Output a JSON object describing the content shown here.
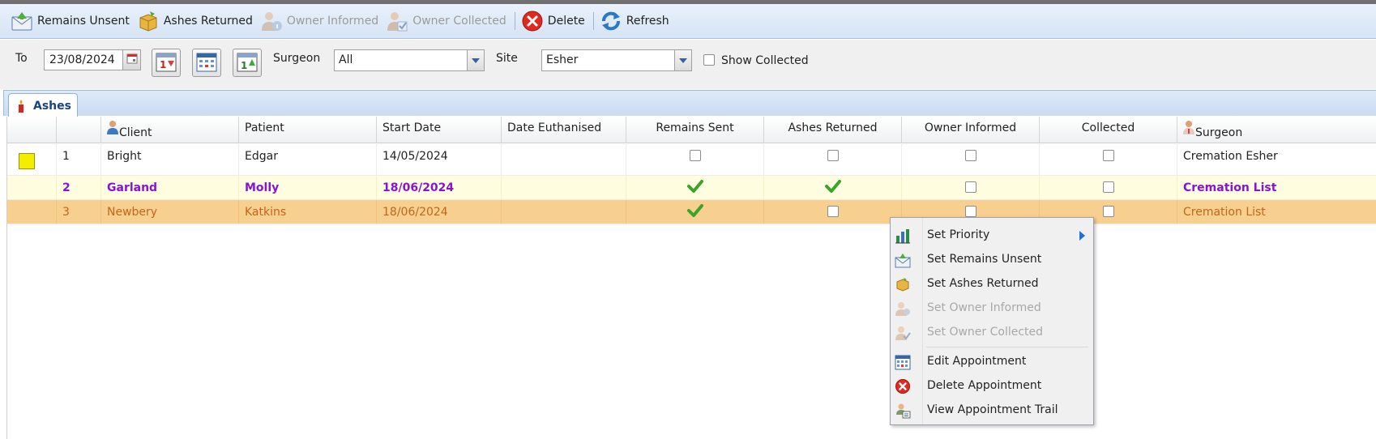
{
  "toolbar": {
    "remains_unsent": "Remains Unsent",
    "ashes_returned": "Ashes Returned",
    "owner_informed": "Owner Informed",
    "owner_collected": "Owner Collected",
    "delete": "Delete",
    "refresh": "Refresh"
  },
  "filters": {
    "to_label": "To",
    "to_date": "23/08/2024",
    "surgeon_label": "Surgeon",
    "surgeon_value": "All",
    "site_label": "Site",
    "site_value": "Esher",
    "show_collected_label": "Show Collected",
    "show_collected_checked": false
  },
  "tabs": [
    {
      "label": "Ashes",
      "icon": "candle-icon"
    }
  ],
  "grid": {
    "columns": [
      "",
      "",
      "Client",
      "Patient",
      "Start Date",
      "Date Euthanised",
      "Remains Sent",
      "Ashes Returned",
      "Owner Informed",
      "Collected",
      "Surgeon"
    ],
    "rows": [
      {
        "priority_color": "#f5ec00",
        "num": "1",
        "client": "Bright",
        "patient": "Edgar",
        "start_date": "14/05/2024",
        "date_euthanised": "",
        "remains_sent": false,
        "ashes_returned": false,
        "owner_informed": false,
        "collected": false,
        "surgeon": "Cremation Esher"
      },
      {
        "priority_color": "",
        "num": "2",
        "client": "Garland",
        "patient": "Molly",
        "start_date": "18/06/2024",
        "date_euthanised": "",
        "remains_sent": true,
        "ashes_returned": true,
        "owner_informed": false,
        "collected": false,
        "surgeon": "Cremation List"
      },
      {
        "priority_color": "",
        "num": "3",
        "client": "Newbery",
        "patient": "Katkins",
        "start_date": "18/06/2024",
        "date_euthanised": "",
        "remains_sent": true,
        "ashes_returned": false,
        "owner_informed": false,
        "collected": false,
        "surgeon": "Cremation List"
      }
    ]
  },
  "context_menu": {
    "items": [
      {
        "label": "Set Priority",
        "icon": "bar-chart-icon",
        "enabled": true,
        "submenu": true
      },
      {
        "label": "Set Remains Unsent",
        "icon": "envelope-icon",
        "enabled": true
      },
      {
        "label": "Set Ashes Returned",
        "icon": "box-icon",
        "enabled": true
      },
      {
        "label": "Set Owner Informed",
        "icon": "person-info-icon",
        "enabled": false
      },
      {
        "label": "Set Owner Collected",
        "icon": "person-check-icon",
        "enabled": false
      },
      {
        "label": "Edit Appointment",
        "icon": "calendar-icon",
        "enabled": true
      },
      {
        "label": "Delete Appointment",
        "icon": "delete-icon",
        "enabled": true
      },
      {
        "label": "View Appointment Trail",
        "icon": "trail-icon",
        "enabled": true
      }
    ]
  },
  "colors": {
    "row_selected_bg": "#f7cf8e",
    "row_selected_text": "#c2661a",
    "row_highlight_bg": "#fefde0",
    "row_highlight_text": "#8a12d6",
    "tab_text": "#15428b"
  }
}
